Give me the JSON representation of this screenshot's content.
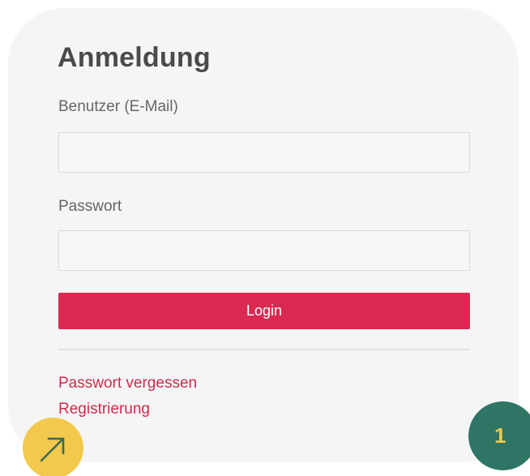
{
  "login_form": {
    "title": "Anmeldung",
    "user_label": "Benutzer (E-Mail)",
    "user_value": "",
    "password_label": "Passwort",
    "password_value": "",
    "login_button": "Login",
    "forgot_password_link": "Passwort vergessen",
    "register_link": "Registrierung"
  },
  "floating": {
    "arrow_button_icon": "arrow-up-right-icon",
    "step_badge": "1"
  },
  "colors": {
    "card_background": "#f5f5f5",
    "primary": "#db2952",
    "link": "#d12a4f",
    "arrow_button": "#f2c94c",
    "badge_background": "#2e7565",
    "badge_text": "#f2c94c"
  }
}
